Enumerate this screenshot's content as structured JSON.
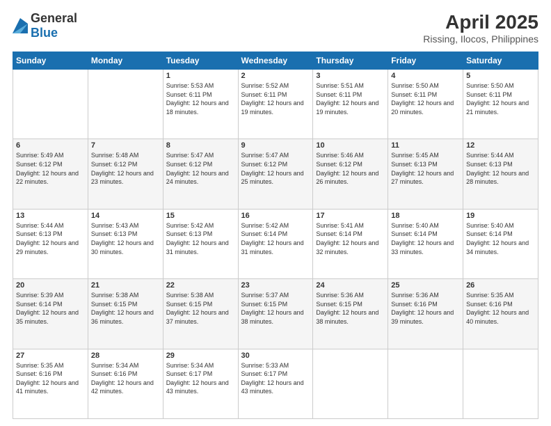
{
  "logo": {
    "general": "General",
    "blue": "Blue"
  },
  "title": "April 2025",
  "location": "Rissing, Ilocos, Philippines",
  "days_of_week": [
    "Sunday",
    "Monday",
    "Tuesday",
    "Wednesday",
    "Thursday",
    "Friday",
    "Saturday"
  ],
  "weeks": [
    [
      {
        "day": "",
        "info": ""
      },
      {
        "day": "",
        "info": ""
      },
      {
        "day": "1",
        "info": "Sunrise: 5:53 AM\nSunset: 6:11 PM\nDaylight: 12 hours and 18 minutes."
      },
      {
        "day": "2",
        "info": "Sunrise: 5:52 AM\nSunset: 6:11 PM\nDaylight: 12 hours and 19 minutes."
      },
      {
        "day": "3",
        "info": "Sunrise: 5:51 AM\nSunset: 6:11 PM\nDaylight: 12 hours and 19 minutes."
      },
      {
        "day": "4",
        "info": "Sunrise: 5:50 AM\nSunset: 6:11 PM\nDaylight: 12 hours and 20 minutes."
      },
      {
        "day": "5",
        "info": "Sunrise: 5:50 AM\nSunset: 6:11 PM\nDaylight: 12 hours and 21 minutes."
      }
    ],
    [
      {
        "day": "6",
        "info": "Sunrise: 5:49 AM\nSunset: 6:12 PM\nDaylight: 12 hours and 22 minutes."
      },
      {
        "day": "7",
        "info": "Sunrise: 5:48 AM\nSunset: 6:12 PM\nDaylight: 12 hours and 23 minutes."
      },
      {
        "day": "8",
        "info": "Sunrise: 5:47 AM\nSunset: 6:12 PM\nDaylight: 12 hours and 24 minutes."
      },
      {
        "day": "9",
        "info": "Sunrise: 5:47 AM\nSunset: 6:12 PM\nDaylight: 12 hours and 25 minutes."
      },
      {
        "day": "10",
        "info": "Sunrise: 5:46 AM\nSunset: 6:12 PM\nDaylight: 12 hours and 26 minutes."
      },
      {
        "day": "11",
        "info": "Sunrise: 5:45 AM\nSunset: 6:13 PM\nDaylight: 12 hours and 27 minutes."
      },
      {
        "day": "12",
        "info": "Sunrise: 5:44 AM\nSunset: 6:13 PM\nDaylight: 12 hours and 28 minutes."
      }
    ],
    [
      {
        "day": "13",
        "info": "Sunrise: 5:44 AM\nSunset: 6:13 PM\nDaylight: 12 hours and 29 minutes."
      },
      {
        "day": "14",
        "info": "Sunrise: 5:43 AM\nSunset: 6:13 PM\nDaylight: 12 hours and 30 minutes."
      },
      {
        "day": "15",
        "info": "Sunrise: 5:42 AM\nSunset: 6:13 PM\nDaylight: 12 hours and 31 minutes."
      },
      {
        "day": "16",
        "info": "Sunrise: 5:42 AM\nSunset: 6:14 PM\nDaylight: 12 hours and 31 minutes."
      },
      {
        "day": "17",
        "info": "Sunrise: 5:41 AM\nSunset: 6:14 PM\nDaylight: 12 hours and 32 minutes."
      },
      {
        "day": "18",
        "info": "Sunrise: 5:40 AM\nSunset: 6:14 PM\nDaylight: 12 hours and 33 minutes."
      },
      {
        "day": "19",
        "info": "Sunrise: 5:40 AM\nSunset: 6:14 PM\nDaylight: 12 hours and 34 minutes."
      }
    ],
    [
      {
        "day": "20",
        "info": "Sunrise: 5:39 AM\nSunset: 6:14 PM\nDaylight: 12 hours and 35 minutes."
      },
      {
        "day": "21",
        "info": "Sunrise: 5:38 AM\nSunset: 6:15 PM\nDaylight: 12 hours and 36 minutes."
      },
      {
        "day": "22",
        "info": "Sunrise: 5:38 AM\nSunset: 6:15 PM\nDaylight: 12 hours and 37 minutes."
      },
      {
        "day": "23",
        "info": "Sunrise: 5:37 AM\nSunset: 6:15 PM\nDaylight: 12 hours and 38 minutes."
      },
      {
        "day": "24",
        "info": "Sunrise: 5:36 AM\nSunset: 6:15 PM\nDaylight: 12 hours and 38 minutes."
      },
      {
        "day": "25",
        "info": "Sunrise: 5:36 AM\nSunset: 6:16 PM\nDaylight: 12 hours and 39 minutes."
      },
      {
        "day": "26",
        "info": "Sunrise: 5:35 AM\nSunset: 6:16 PM\nDaylight: 12 hours and 40 minutes."
      }
    ],
    [
      {
        "day": "27",
        "info": "Sunrise: 5:35 AM\nSunset: 6:16 PM\nDaylight: 12 hours and 41 minutes."
      },
      {
        "day": "28",
        "info": "Sunrise: 5:34 AM\nSunset: 6:16 PM\nDaylight: 12 hours and 42 minutes."
      },
      {
        "day": "29",
        "info": "Sunrise: 5:34 AM\nSunset: 6:17 PM\nDaylight: 12 hours and 43 minutes."
      },
      {
        "day": "30",
        "info": "Sunrise: 5:33 AM\nSunset: 6:17 PM\nDaylight: 12 hours and 43 minutes."
      },
      {
        "day": "",
        "info": ""
      },
      {
        "day": "",
        "info": ""
      },
      {
        "day": "",
        "info": ""
      }
    ]
  ]
}
